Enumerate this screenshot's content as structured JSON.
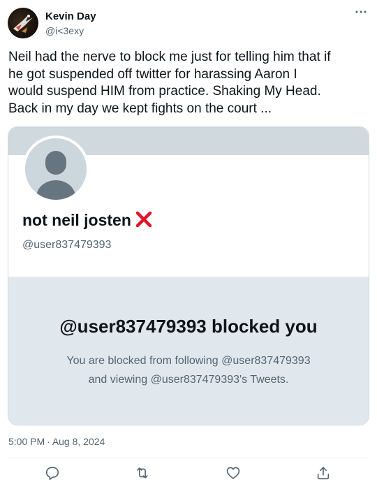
{
  "author": {
    "name": "Kevin Day",
    "handle": "@i<3exy"
  },
  "tweet": {
    "text": "Neil had the nerve to block me just for telling him that if\nhe got suspended off twitter for harassing Aaron I\nwould suspend HIM from practice. Shaking My Head.\nBack in my day we kept fights on the court ..."
  },
  "card": {
    "name": "not neil josten",
    "name_emoji_icon": "red-x-icon",
    "handle": "@user837479393",
    "blocked_title": "@user837479393 blocked you",
    "blocked_line1": "You are blocked from following @user837479393",
    "blocked_line2": "and viewing @user837479393's Tweets."
  },
  "meta": {
    "time": "5:00 PM",
    "separator": "·",
    "date": "Aug 8, 2024"
  },
  "actions": [
    "reply-icon",
    "retweet-icon",
    "like-icon",
    "share-icon"
  ],
  "colors": {
    "text": "#0f1419",
    "secondary": "#536471",
    "banner": "#cfd9de",
    "blocked_panel": "#e1e8ed",
    "red_x": "#e0142a"
  }
}
